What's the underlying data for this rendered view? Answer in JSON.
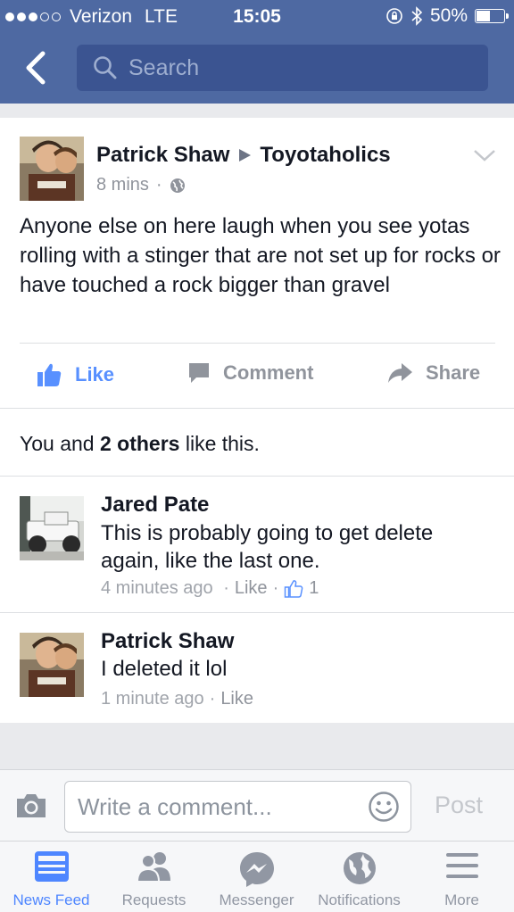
{
  "status_bar": {
    "carrier": "Verizon",
    "network": "LTE",
    "time": "15:05",
    "battery": "50%",
    "battery_level": 0.5
  },
  "nav": {
    "search_placeholder": "Search"
  },
  "post": {
    "author": "Patrick Shaw",
    "group": "Toyotaholics",
    "time": "8 mins",
    "text": "Anyone else on here laugh when you see yotas rolling with a stinger that are not set up for rocks or have touched a rock bigger than gravel",
    "actions": {
      "like": "Like",
      "comment": "Comment",
      "share": "Share"
    },
    "likes": {
      "prefix": "You and ",
      "count": "2 others",
      "suffix": " like this."
    }
  },
  "comments": [
    {
      "name": "Jared Pate",
      "text": "This is probably going to get delete again, like the last one.",
      "time": "4 minutes ago",
      "like": "Like",
      "like_count": "1"
    },
    {
      "name": "Patrick Shaw",
      "text": "I deleted it lol",
      "time": "1 minute ago",
      "like": "Like"
    }
  ],
  "composer": {
    "placeholder": "Write a comment...",
    "post": "Post"
  },
  "tabs": [
    {
      "label": "News Feed",
      "icon": "news-feed-icon",
      "active": true
    },
    {
      "label": "Requests",
      "icon": "requests-icon"
    },
    {
      "label": "Messenger",
      "icon": "messenger-icon"
    },
    {
      "label": "Notifications",
      "icon": "globe-icon"
    },
    {
      "label": "More",
      "icon": "menu-icon"
    }
  ],
  "colors": {
    "brand": "#4e69a2",
    "link": "#5890ff",
    "active_tab": "#4e86ff"
  }
}
